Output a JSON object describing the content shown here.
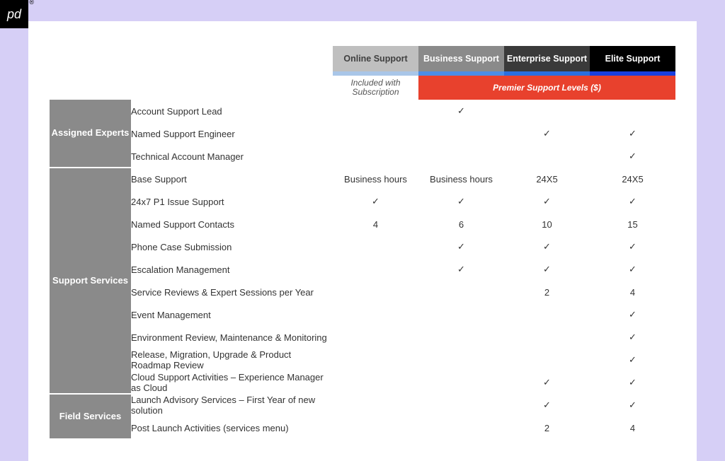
{
  "tiers": [
    {
      "name": "Online Support",
      "headClass": "light1",
      "stripeClass": "s1"
    },
    {
      "name": "Business Support",
      "headClass": "light2",
      "stripeClass": "s2"
    },
    {
      "name": "Enterprise Support",
      "headClass": "dark1",
      "stripeClass": "s3"
    },
    {
      "name": "Elite Support",
      "headClass": "dark2",
      "stripeClass": "s4"
    }
  ],
  "subheader": {
    "included": "Included with Subscription",
    "premier": "Premier Support Levels ($)"
  },
  "categories": [
    {
      "name": "Assigned Experts",
      "rows": [
        {
          "feature": "Account Support Lead",
          "values": [
            "",
            "✓",
            "",
            ""
          ]
        },
        {
          "feature": "Named Support Engineer",
          "values": [
            "",
            "",
            "✓",
            "✓"
          ]
        },
        {
          "feature": "Technical Account Manager",
          "values": [
            "",
            "",
            "",
            "✓"
          ]
        }
      ]
    },
    {
      "name": "Support Services",
      "rows": [
        {
          "feature": "Base Support",
          "values": [
            "Business hours",
            "Business hours",
            "24X5",
            "24X5"
          ]
        },
        {
          "feature": "24x7 P1 Issue Support",
          "values": [
            "✓",
            "✓",
            "✓",
            "✓"
          ]
        },
        {
          "feature": "Named Support Contacts",
          "values": [
            "4",
            "6",
            "10",
            "15"
          ]
        },
        {
          "feature": "Phone Case Submission",
          "values": [
            "",
            "✓",
            "✓",
            "✓"
          ]
        },
        {
          "feature": "Escalation Management",
          "values": [
            "",
            "✓",
            "✓",
            "✓"
          ]
        },
        {
          "feature": "Service Reviews & Expert Sessions per Year",
          "values": [
            "",
            "",
            "2",
            "4"
          ]
        },
        {
          "feature": "Event Management",
          "values": [
            "",
            "",
            "",
            "✓"
          ]
        },
        {
          "feature": "Environment Review, Maintenance &  Monitoring",
          "values": [
            "",
            "",
            "",
            "✓"
          ]
        },
        {
          "feature": "Release, Migration, Upgrade & Product Roadmap Review",
          "values": [
            "",
            "",
            "",
            "✓"
          ]
        },
        {
          "feature": "Cloud Support Activities – Experience Manager as Cloud",
          "values": [
            "",
            "",
            "✓",
            "✓"
          ]
        }
      ]
    },
    {
      "name": "Field Services",
      "rows": [
        {
          "feature": "Launch Advisory Services – First Year of new solution",
          "values": [
            "",
            "",
            "✓",
            "✓"
          ]
        },
        {
          "feature": "Post Launch Activities (services menu)",
          "values": [
            "",
            "",
            "2",
            "4"
          ]
        }
      ]
    }
  ]
}
